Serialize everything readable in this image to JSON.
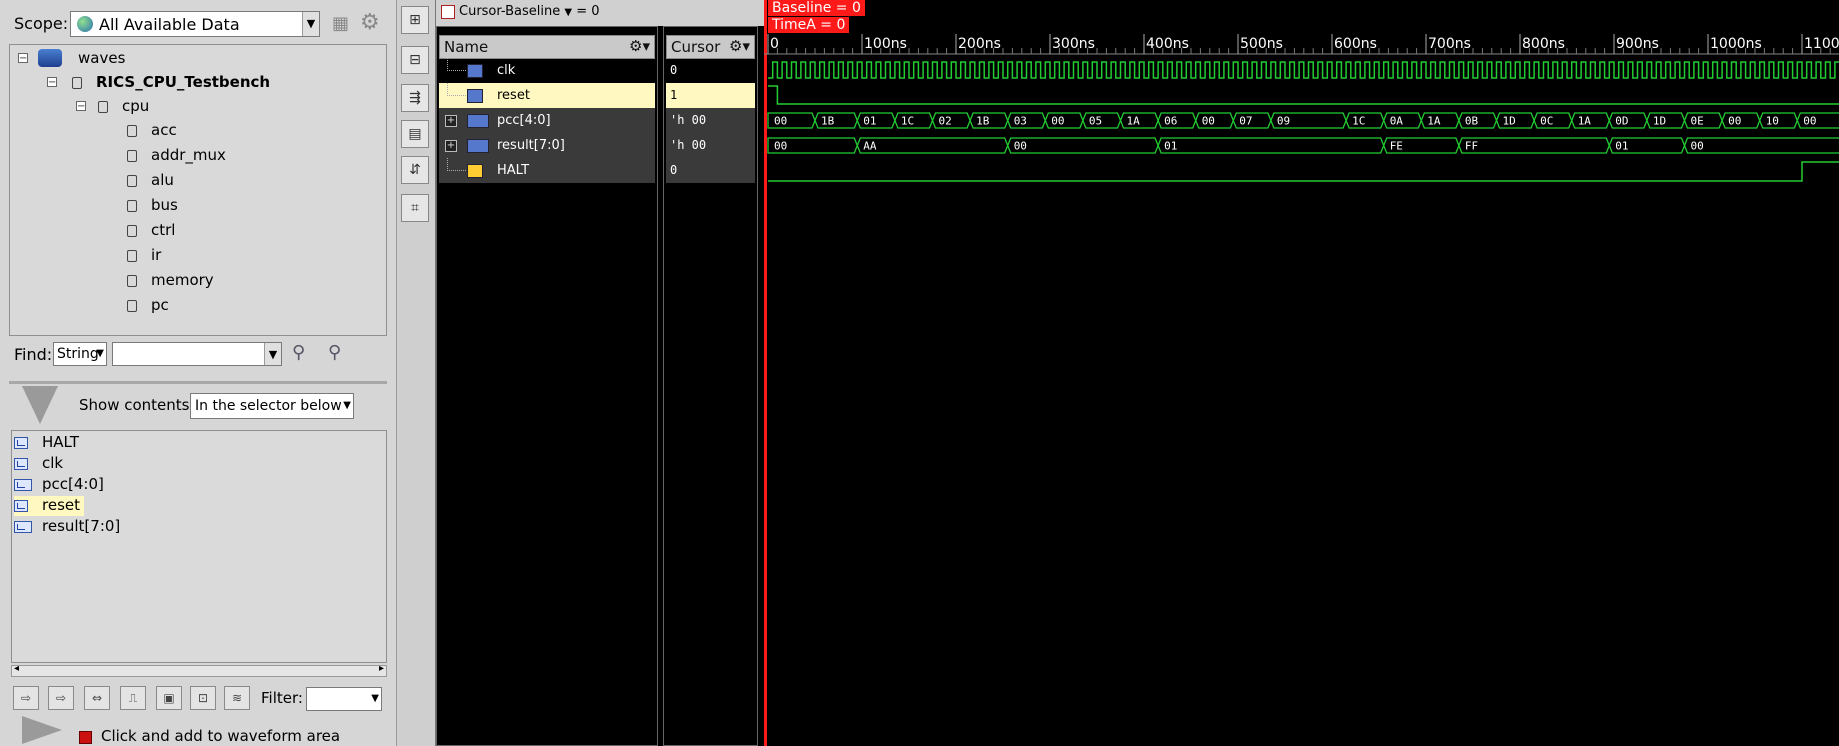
{
  "scope": {
    "label": "Scope:",
    "value": "All Available Data"
  },
  "tree": {
    "root": "waves",
    "testbench": "RICS_CPU_Testbench",
    "cpu": "cpu",
    "children": [
      "acc",
      "addr_mux",
      "alu",
      "bus",
      "ctrl",
      "ir",
      "memory",
      "pc"
    ]
  },
  "find": {
    "label": "Find:",
    "mode": "String",
    "value": ""
  },
  "show_contents": {
    "label": "Show contents:",
    "value": "In the selector below"
  },
  "signal_list": [
    {
      "name": "HALT",
      "bus": false,
      "selected": false
    },
    {
      "name": "clk",
      "bus": false,
      "selected": false
    },
    {
      "name": "pcc[4:0]",
      "bus": true,
      "selected": false
    },
    {
      "name": "reset",
      "bus": false,
      "selected": true
    },
    {
      "name": "result[7:0]",
      "bus": true,
      "selected": false
    }
  ],
  "filter_label": "Filter:",
  "click_add_label": "Click and add to waveform area",
  "cursor_baseline": {
    "label": "Cursor-Baseline",
    "value": "= 0"
  },
  "name_header": "Name",
  "cursor_header": "Cursor",
  "wave_rows": [
    {
      "name": "clk",
      "cursor": "0",
      "bus": false,
      "expand": false,
      "selected": false
    },
    {
      "name": "reset",
      "cursor": "1",
      "bus": false,
      "expand": false,
      "selected": true
    },
    {
      "name": "pcc[4:0]",
      "cursor": "'h 00",
      "bus": true,
      "expand": true,
      "selected": false
    },
    {
      "name": "result[7:0]",
      "cursor": "'h 00",
      "bus": true,
      "expand": true,
      "selected": false
    },
    {
      "name": "HALT",
      "cursor": "0",
      "bus": false,
      "expand": false,
      "selected": false
    }
  ],
  "markers": {
    "baseline": "Baseline = 0",
    "timea": "TimeA = 0"
  },
  "timeline": {
    "ticks": [
      "0",
      "100ns",
      "200ns",
      "300ns",
      "400ns",
      "500ns",
      "600ns",
      "700ns",
      "800ns",
      "900ns",
      "1000ns",
      "1100"
    ]
  },
  "waves": {
    "time_end_ns": 1140,
    "clk_period_ns": 10,
    "reset_fall_ns": 10,
    "halt_rise_ns": 1100,
    "pcc": [
      {
        "t": 0,
        "v": "00"
      },
      {
        "t": 50,
        "v": "1B"
      },
      {
        "t": 95,
        "v": "01"
      },
      {
        "t": 135,
        "v": "1C"
      },
      {
        "t": 175,
        "v": "02"
      },
      {
        "t": 215,
        "v": "1B"
      },
      {
        "t": 255,
        "v": "03"
      },
      {
        "t": 295,
        "v": "00"
      },
      {
        "t": 335,
        "v": "05"
      },
      {
        "t": 375,
        "v": "1A"
      },
      {
        "t": 415,
        "v": "06"
      },
      {
        "t": 455,
        "v": "00"
      },
      {
        "t": 495,
        "v": "07"
      },
      {
        "t": 535,
        "v": "09"
      },
      {
        "t": 615,
        "v": "1C"
      },
      {
        "t": 655,
        "v": "0A"
      },
      {
        "t": 695,
        "v": "1A"
      },
      {
        "t": 735,
        "v": "0B"
      },
      {
        "t": 775,
        "v": "1D"
      },
      {
        "t": 815,
        "v": "0C"
      },
      {
        "t": 855,
        "v": "1A"
      },
      {
        "t": 895,
        "v": "0D"
      },
      {
        "t": 935,
        "v": "1D"
      },
      {
        "t": 975,
        "v": "0E"
      },
      {
        "t": 1015,
        "v": "00"
      },
      {
        "t": 1055,
        "v": "10"
      },
      {
        "t": 1095,
        "v": "00"
      }
    ],
    "result": [
      {
        "t": 0,
        "v": "00"
      },
      {
        "t": 95,
        "v": "AA"
      },
      {
        "t": 255,
        "v": "00"
      },
      {
        "t": 415,
        "v": "01"
      },
      {
        "t": 655,
        "v": "FE"
      },
      {
        "t": 735,
        "v": "FF"
      },
      {
        "t": 895,
        "v": "01"
      },
      {
        "t": 975,
        "v": "00"
      }
    ]
  },
  "colors": {
    "wave": "#22cc33",
    "marker": "#ff1a1a",
    "selected_row": "#fff8c0",
    "panel": "#d6d6d6"
  }
}
